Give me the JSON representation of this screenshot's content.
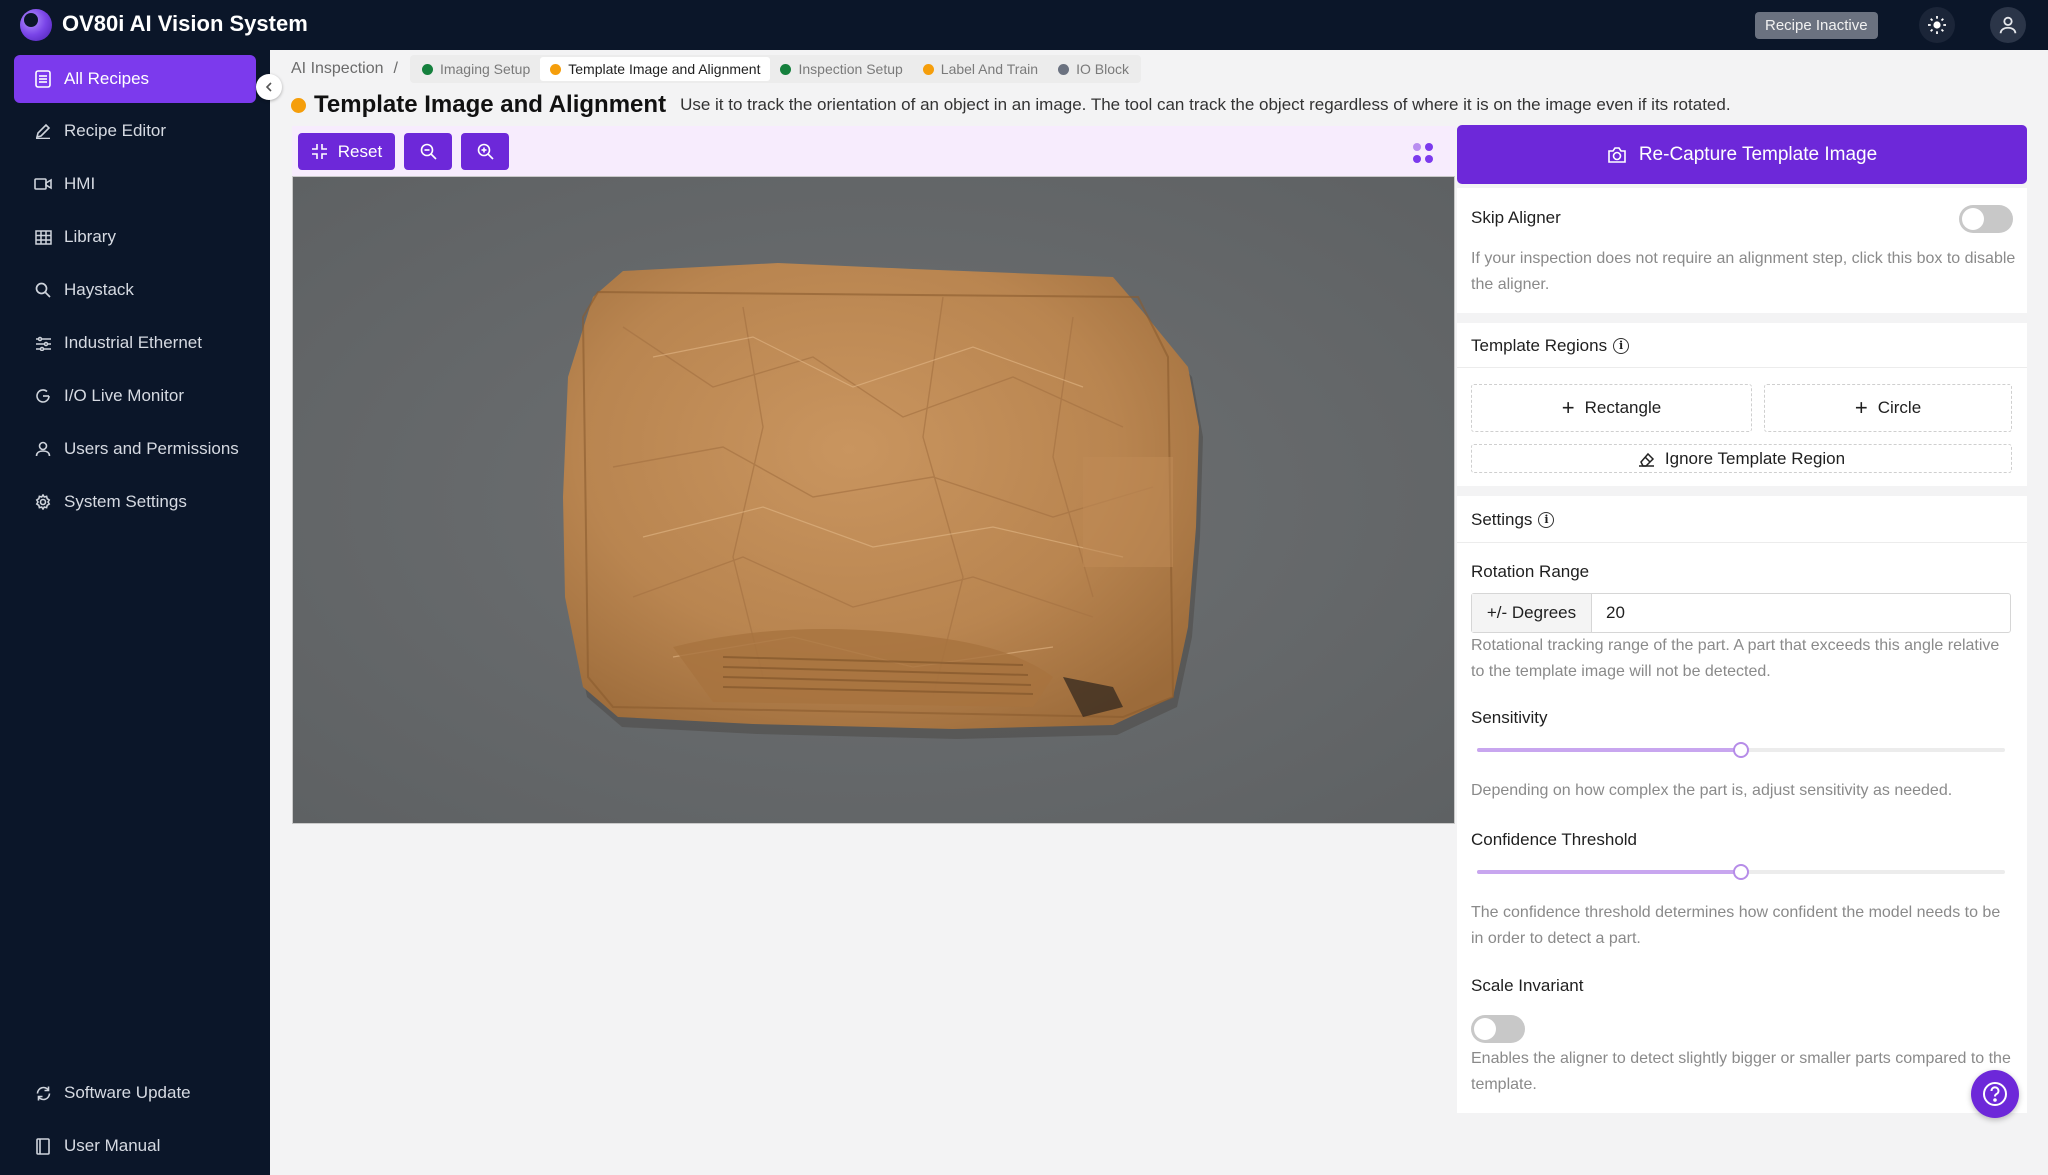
{
  "app": {
    "title": "OV80i AI Vision System",
    "status": "Recipe Inactive"
  },
  "sidebar": {
    "items": [
      {
        "label": "All Recipes",
        "icon": "document-list-icon",
        "active": true
      },
      {
        "label": "Recipe Editor",
        "icon": "pencil-icon"
      },
      {
        "label": "HMI",
        "icon": "video-icon"
      },
      {
        "label": "Library",
        "icon": "table-icon"
      },
      {
        "label": "Haystack",
        "icon": "search-icon"
      },
      {
        "label": "Industrial Ethernet",
        "icon": "network-icon"
      },
      {
        "label": "I/O Live Monitor",
        "icon": "gauge-icon"
      },
      {
        "label": "Users and Permissions",
        "icon": "user-icon"
      },
      {
        "label": "System Settings",
        "icon": "gear-icon"
      }
    ],
    "footer": [
      {
        "label": "Software Update",
        "icon": "refresh-icon"
      },
      {
        "label": "User Manual",
        "icon": "book-icon"
      }
    ]
  },
  "breadcrumb": {
    "root": "AI Inspection",
    "separator": "/",
    "steps": [
      {
        "label": "Imaging Setup",
        "color": "#15803d"
      },
      {
        "label": "Template Image and Alignment",
        "color": "#f59e0b",
        "active": true
      },
      {
        "label": "Inspection Setup",
        "color": "#15803d"
      },
      {
        "label": "Label And Train",
        "color": "#f59e0b"
      },
      {
        "label": "IO Block",
        "color": "#6b7280"
      }
    ]
  },
  "page": {
    "title": "Template Image and Alignment",
    "description": "Use it to track the orientation of an object in an image. The tool can track the object regardless of where it is on the image even if its rotated.",
    "status_color": "#f59e0b"
  },
  "toolbar": {
    "reset_label": "Reset"
  },
  "panel": {
    "recapture_label": "Re-Capture Template Image",
    "skip_aligner": {
      "label": "Skip Aligner",
      "enabled": false,
      "help": "If your inspection does not require an alignment step, click this box to disable the aligner."
    },
    "template_regions": {
      "title": "Template Regions",
      "rectangle_label": "Rectangle",
      "circle_label": "Circle",
      "ignore_label": "Ignore Template Region"
    },
    "settings": {
      "title": "Settings",
      "rotation": {
        "label": "Rotation Range",
        "addon": "+/- Degrees",
        "value": "20",
        "help": "Rotational tracking range of the part. A part that exceeds this angle relative to the template image will not be detected."
      },
      "sensitivity": {
        "label": "Sensitivity",
        "level": 0.5,
        "help": "Depending on how complex the part is, adjust sensitivity as needed."
      },
      "confidence": {
        "label": "Confidence Threshold",
        "level": 0.5,
        "help": "The confidence threshold determines how confident the model needs to be in order to detect a part."
      },
      "scale_invariant": {
        "label": "Scale Invariant",
        "enabled": false,
        "help": "Enables the aligner to detect slightly bigger or smaller parts compared to the template."
      }
    }
  },
  "colors": {
    "accent": "#6d28d9",
    "active_nav": "#7c3aed",
    "sidebar_bg": "#0b1629"
  }
}
